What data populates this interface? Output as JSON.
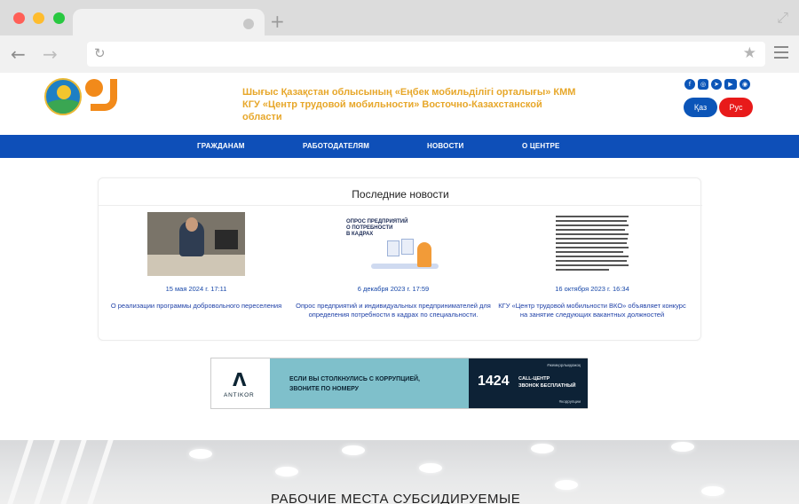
{
  "browser": {
    "new_tab_symbol": "+",
    "back_symbol": "←",
    "forward_symbol": "→",
    "reload_symbol": "↻",
    "star_symbol": "★",
    "resize_symbol": "⤢"
  },
  "header": {
    "title_line1": "Шығыс Қазақстан облысының «Еңбек мобильділігі орталығы» КММ",
    "title_line2": "КГУ «Центр трудовой мобильности» Восточно-Казахстанской области",
    "lang_kz": "Қаз",
    "lang_ru": "Рус",
    "social_icons": [
      "facebook-icon",
      "instagram-icon",
      "telegram-icon",
      "youtube-icon",
      "eye-icon"
    ]
  },
  "nav": {
    "items": [
      "ГРАЖДАНАМ",
      "РАБОТОДАТЕЛЯМ",
      "НОВОСТИ",
      "О ЦЕНТРЕ"
    ]
  },
  "news": {
    "heading": "Последние новости",
    "items": [
      {
        "date": "15 мая 2024 г. 17:11",
        "title": "О реализации программы добровольного переселения"
      },
      {
        "date": "6 декабря 2023 г. 17:59",
        "title": "Опрос предприятий и индивидуальных предпринимателей для определения потребности в кадрах по специальности."
      },
      {
        "date": "16 октября 2023 г. 16:34",
        "title": "КГУ «Центр трудовой мобильности ВКО» объявляет конкурс на занятие следующих вакантных должностей"
      }
    ],
    "survey_image_text": "ОПРОС ПРЕДПРИЯТИЙ\nО ПОТРЕБНОСТИ\nВ КАДРАХ"
  },
  "banner": {
    "brand": "ANTIKOR",
    "text_line1": "ЕСЛИ ВЫ СТОЛКНУЛИСЬ С КОРРУПЦИЕЙ,",
    "text_line2": "ЗВОНИТЕ ПО НОМЕРУ",
    "number": "1424",
    "call_line1": "CALL-ЦЕНТР",
    "call_line2": "ЗВОНОК БЕСПЛАТНЫЙ",
    "hashtag_top": "#жемқорлыққажоқ",
    "hashtag_bottom": "#коррупции"
  },
  "hero": {
    "title": "РАБОЧИЕ МЕСТА СУБСИДИРУЕМЫЕ"
  },
  "colors": {
    "nav_blue": "#0e4fb8",
    "title_orange": "#e7a72a",
    "lang_red": "#e81a1a",
    "link_blue": "#1d3fa6"
  }
}
